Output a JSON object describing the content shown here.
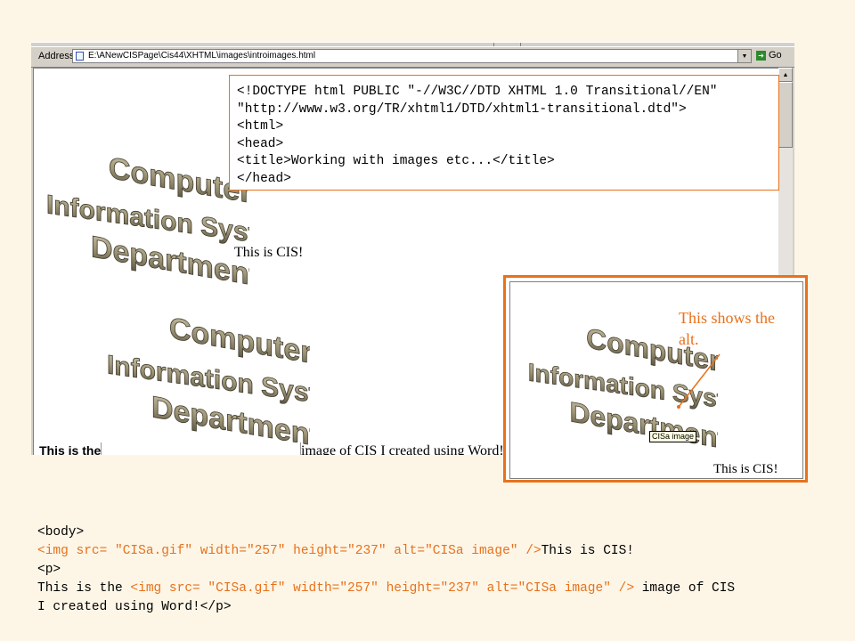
{
  "browser": {
    "address_label": "Address",
    "url": "E:\\ANewCISPage\\Cis44\\XHTML\\images\\introimages.html",
    "go_label": "Go",
    "page": {
      "logo_lines": [
        "Computer",
        "Information Systems",
        "Department"
      ],
      "first_text": "This is CIS!",
      "second_text_before": "This is the",
      "second_text_after": "image of CIS I created using Word!"
    }
  },
  "head_code": [
    "<!DOCTYPE html PUBLIC \"-//W3C//DTD XHTML 1.0 Transitional//EN\"",
    "\"http://www.w3.org/TR/xhtml1/DTD/xhtml1-transitional.dtd\">",
    "<html>",
    "<head>",
    "<title>Working with images etc...</title>",
    "</head>"
  ],
  "callout": {
    "note": "This shows the alt.",
    "tooltip": "CISa image",
    "caption": "This is CIS!"
  },
  "body_code": {
    "line1": "<body>",
    "line2_tag": "<img src= \"CISa.gif\" width=\"257\" height=\"237\" alt=\"CISa image\" />",
    "line2_text": "This is CIS!",
    "line3": "<p>",
    "line4_text": "This is the ",
    "line4_tag": "<img src= \"CISa.gif\" width=\"257\" height=\"237\" alt=\"CISa image\" />",
    "line4_tail": " image of CIS",
    "line5": "I created using Word!</p>"
  },
  "colors": {
    "accent": "#e8711c",
    "background": "#fdf6e7"
  }
}
